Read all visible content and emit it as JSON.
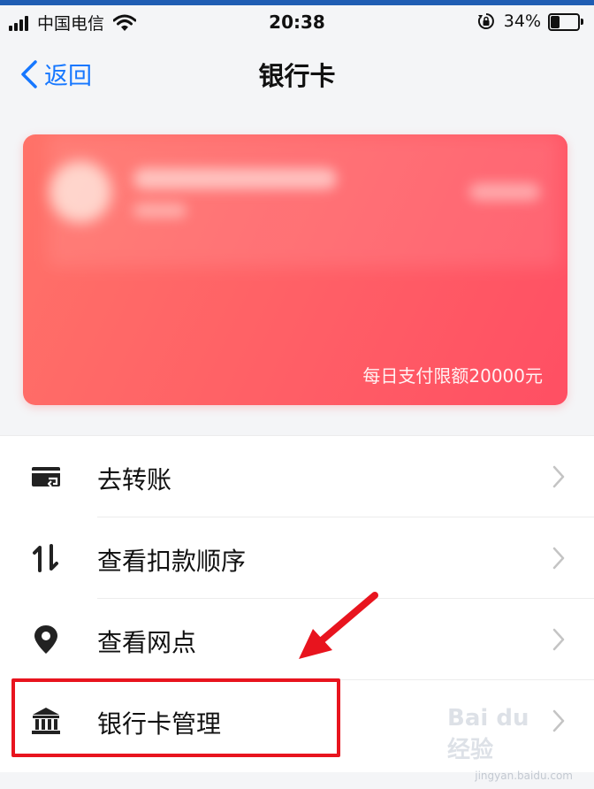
{
  "status_bar": {
    "carrier": "中国电信",
    "time": "20:38",
    "battery_percent": "34%",
    "battery_level": 0.34
  },
  "nav": {
    "back_label": "返回",
    "title": "银行卡"
  },
  "card": {
    "limit_text": "每日支付限额20000元"
  },
  "menu": {
    "items": [
      {
        "label": "去转账",
        "icon": "wallet-transfer-icon"
      },
      {
        "label": "查看扣款顺序",
        "icon": "sort-order-icon"
      },
      {
        "label": "查看网点",
        "icon": "location-pin-icon"
      },
      {
        "label": "银行卡管理",
        "icon": "bank-building-icon"
      }
    ]
  },
  "annotations": {
    "highlight_color": "#e8141e",
    "highlight_target": "银行卡管理"
  },
  "watermark": {
    "brand": "Bai du 经验",
    "url": "jingyan.baidu.com"
  },
  "colors": {
    "accent": "#1677ff",
    "card_gradient_start": "#ff7268",
    "card_gradient_end": "#ff4f63",
    "background": "#f4f5f7"
  }
}
